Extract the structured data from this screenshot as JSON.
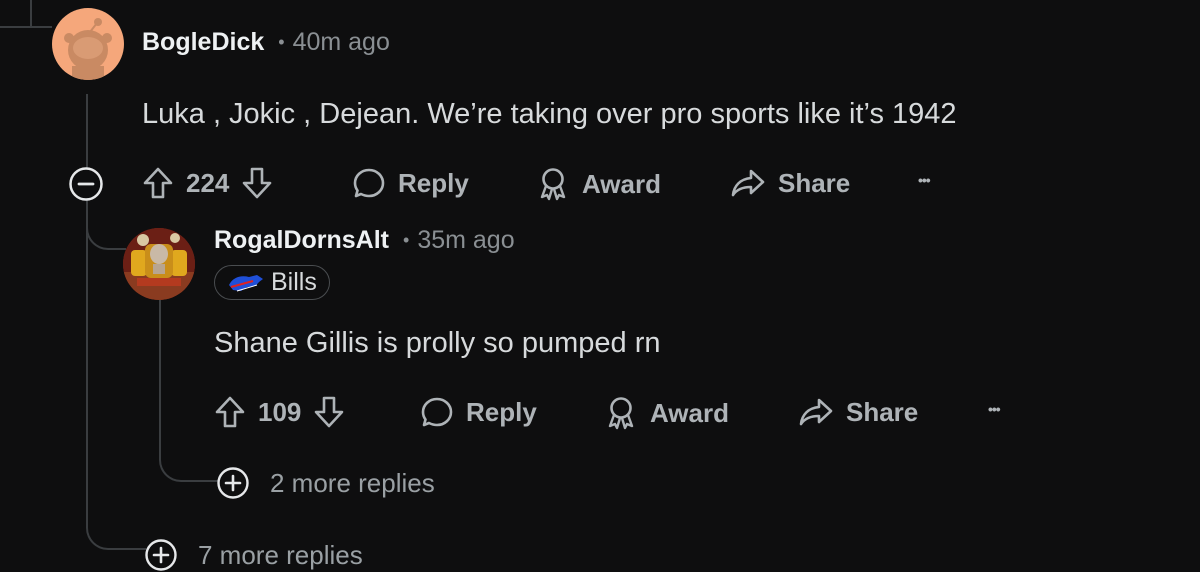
{
  "colors": {
    "background": "#0e0e0f",
    "avatar_bg": "#f5a77b",
    "thread_line": "#3a3d40"
  },
  "comment1": {
    "username": "BogleDick",
    "separator": "•",
    "time": "40m ago",
    "body": "Luka , Jokic , Dejean. We’re taking over pro sports like it’s 1942",
    "votes": "224",
    "reply_label": "Reply",
    "award_label": "Award",
    "share_label": "Share",
    "more_label": "•••",
    "more_replies": "7 more replies"
  },
  "comment2": {
    "username": "RogalDornsAlt",
    "separator": "•",
    "time": "35m ago",
    "flair": "Bills",
    "body": "Shane Gillis is prolly so pumped rn",
    "votes": "109",
    "reply_label": "Reply",
    "award_label": "Award",
    "share_label": "Share",
    "more_label": "•••",
    "more_replies": "2 more replies"
  }
}
